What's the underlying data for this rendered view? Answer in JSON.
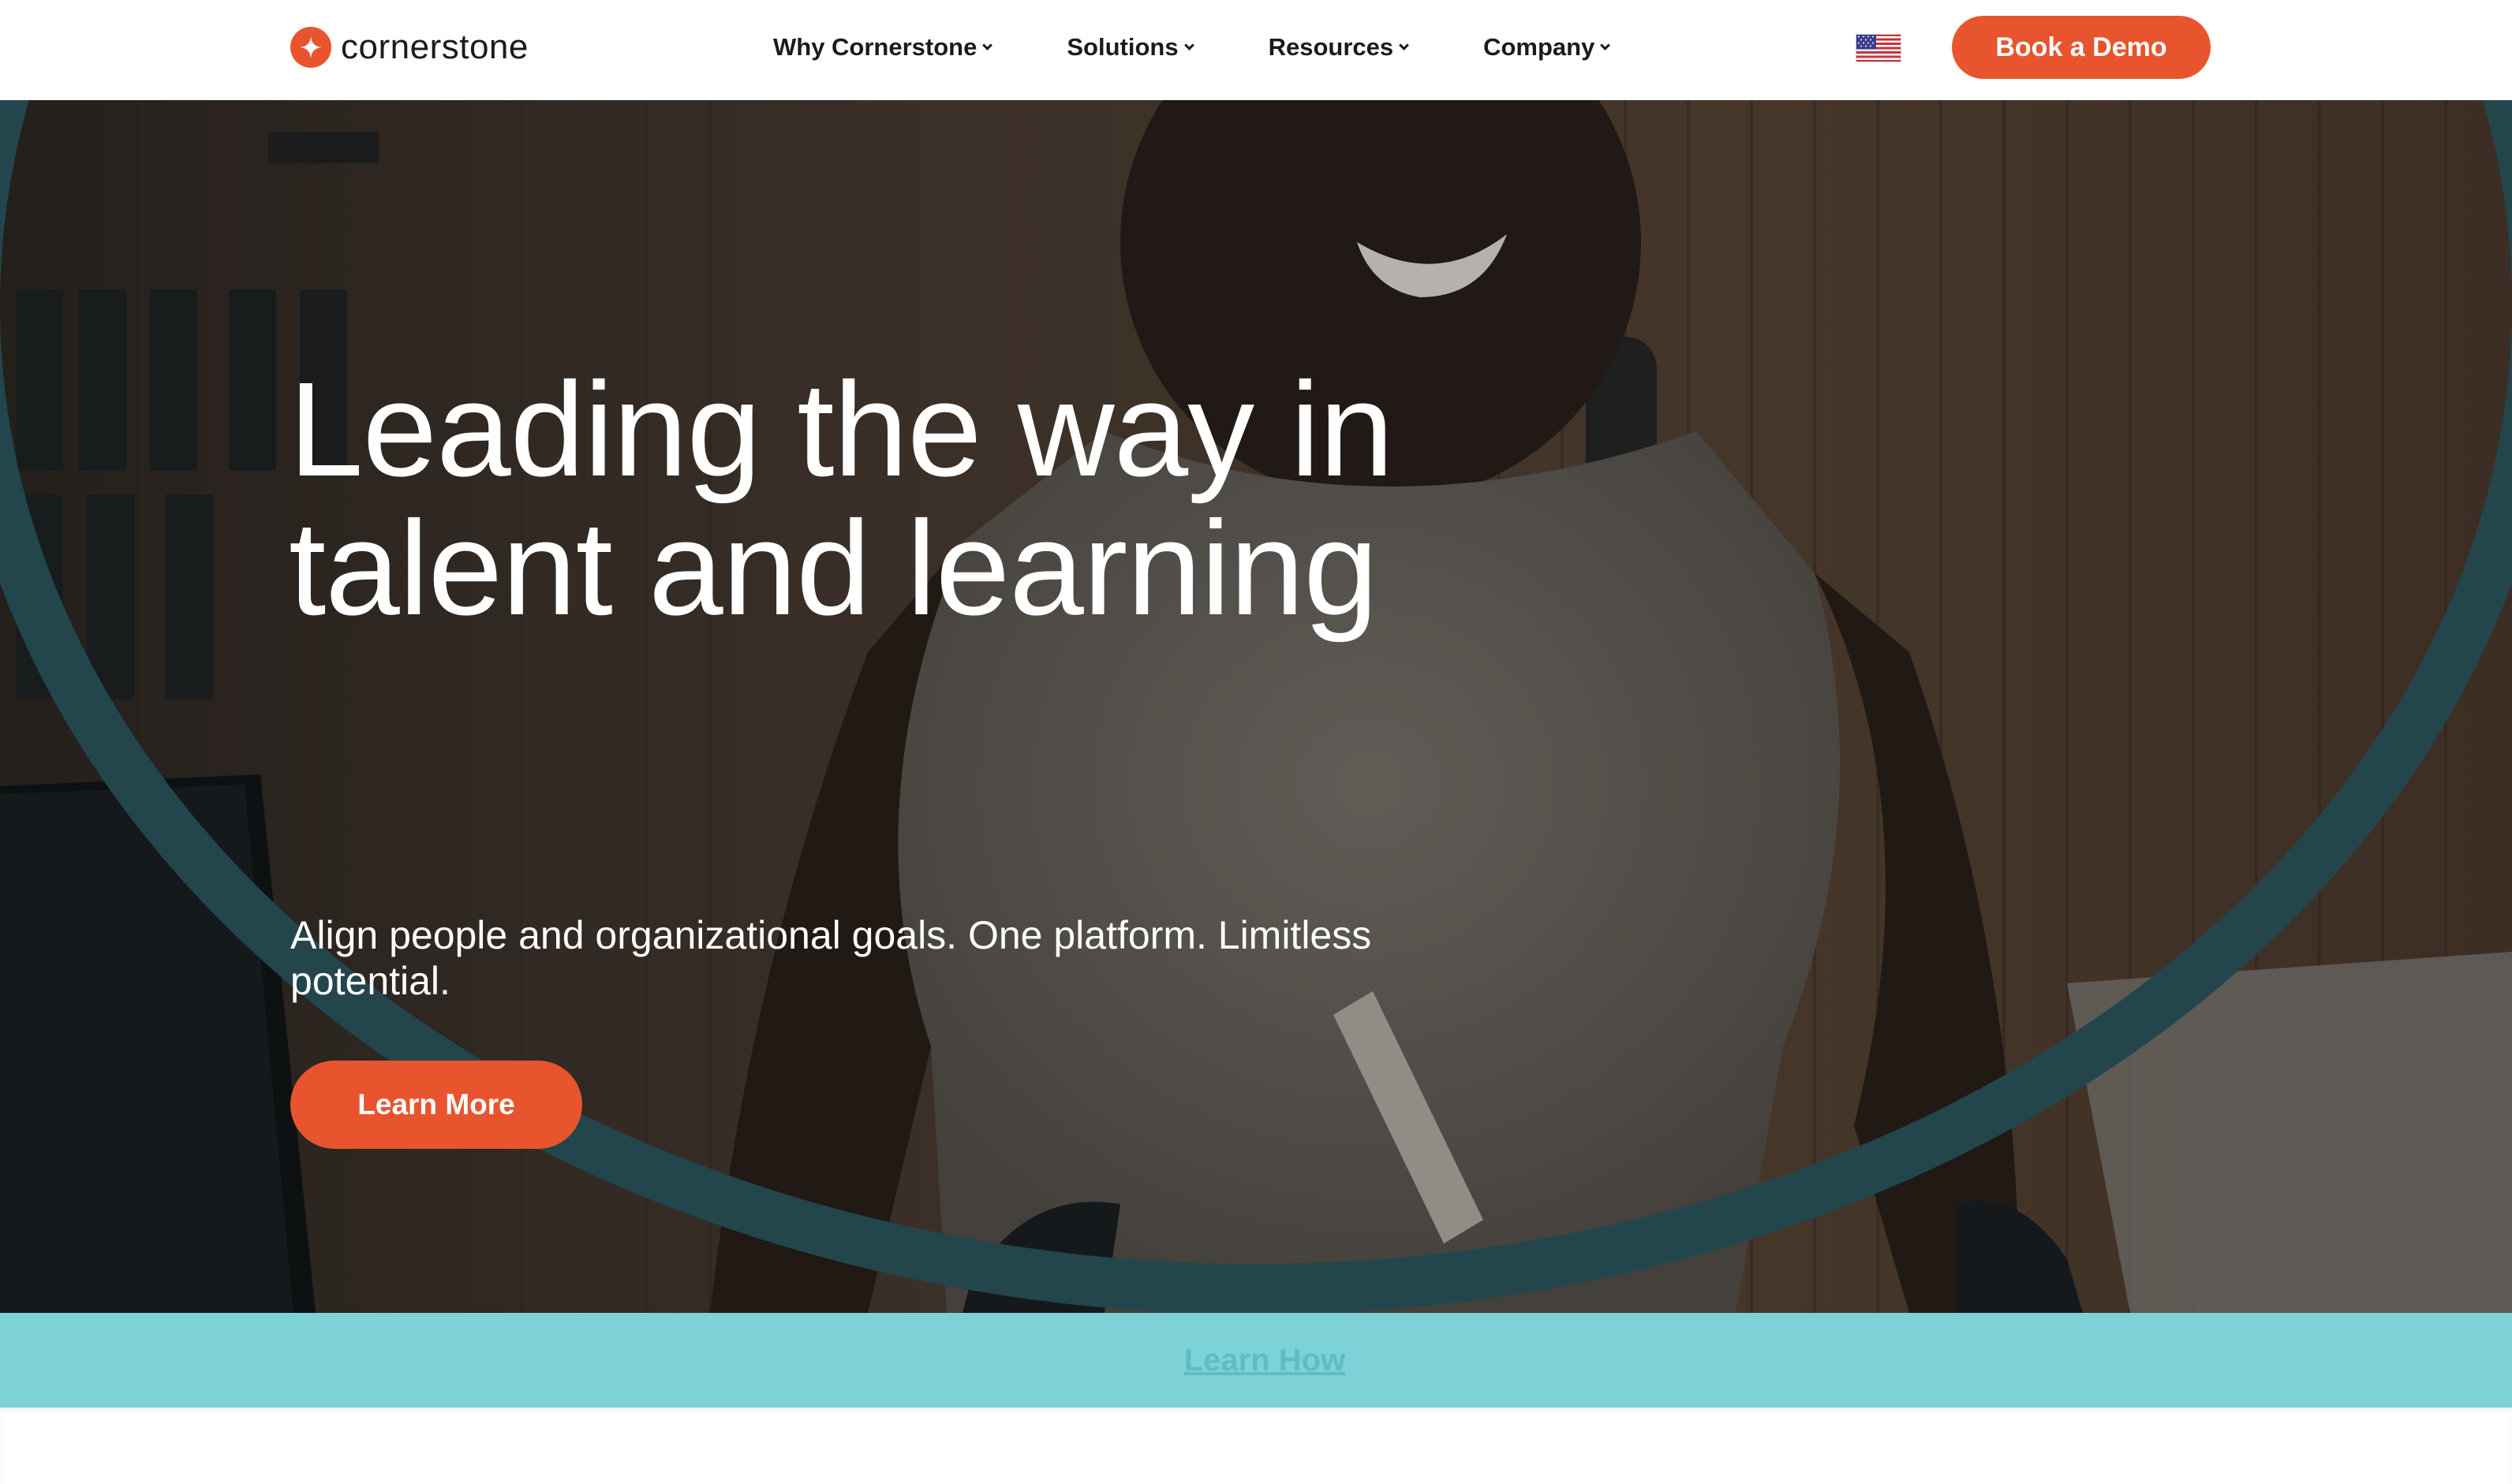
{
  "nav": {
    "logo_text": "cornerstone",
    "menu": [
      {
        "label": "Why Cornerstone"
      },
      {
        "label": "Solutions"
      },
      {
        "label": "Resources"
      },
      {
        "label": "Company"
      }
    ],
    "locale_icon": "us-flag-icon",
    "cta_label": "Book a Demo"
  },
  "hero": {
    "headline": "Leading the way in talent and learning",
    "subtext": "Align people and organizational goals. One platform. Limitless potential.",
    "cta_label": "Learn More"
  },
  "banner": {
    "text": "",
    "link_label": "Learn How"
  },
  "colors": {
    "accent": "#e8542e",
    "banner": "#7dd2d8",
    "arc": "#2e5a63"
  }
}
